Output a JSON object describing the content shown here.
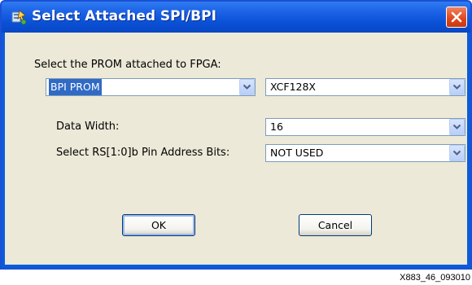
{
  "window": {
    "title": "Select Attached SPI/BPI"
  },
  "form": {
    "prompt_label": "Select the PROM attached to FPGA:",
    "prom_type": {
      "value": "BPI PROM"
    },
    "prom_part": {
      "value": "XCF128X"
    },
    "data_width_label": "Data Width:",
    "data_width": {
      "value": "16"
    },
    "rs_pins_label": "Select RS[1:0]b Pin Address Bits:",
    "rs_pins": {
      "value": "NOT USED"
    }
  },
  "buttons": {
    "ok_label": "OK",
    "cancel_label": "Cancel"
  },
  "figure_id": "X883_46_093010",
  "colors": {
    "titlebar": "#0a50d6",
    "client_background": "#ece9d8",
    "selection": "#316ac5",
    "close_button": "#e0451d"
  },
  "icons": {
    "app": "app-icon",
    "close": "close-icon",
    "dropdown": "chevron-down-icon"
  }
}
